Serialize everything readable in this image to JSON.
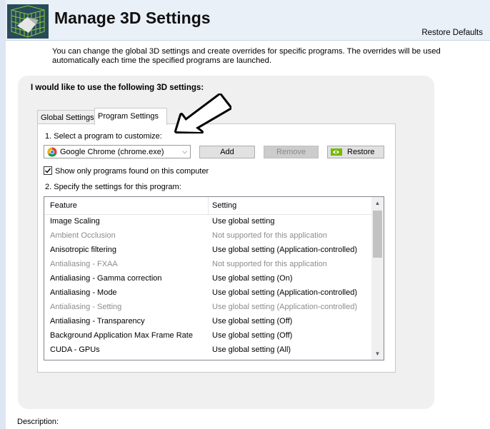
{
  "header": {
    "title": "Manage 3D Settings",
    "restore_defaults": "Restore Defaults",
    "icon": "nvidia-3d-cube-icon"
  },
  "intro": "You can change the global 3D settings and create overrides for specific programs. The overrides will be used automatically each time the specified programs are launched.",
  "panel": {
    "heading": "I would like to use the following 3D settings:",
    "tabs": [
      {
        "label": "Global Settings",
        "active": false
      },
      {
        "label": "Program Settings",
        "active": true
      }
    ]
  },
  "program_settings": {
    "step1_label": "1. Select a program to customize:",
    "selected_program": "Google Chrome (chrome.exe)",
    "add_label": "Add",
    "remove_label": "Remove",
    "restore_label": "Restore",
    "show_only_label": "Show only programs found on this computer",
    "show_only_checked": true,
    "step2_label": "2. Specify the settings for this program:"
  },
  "table": {
    "columns": [
      "Feature",
      "Setting"
    ],
    "rows": [
      {
        "feature": "Image Scaling",
        "setting": "Use global setting",
        "disabled": false
      },
      {
        "feature": "Ambient Occlusion",
        "setting": "Not supported for this application",
        "disabled": true
      },
      {
        "feature": "Anisotropic filtering",
        "setting": "Use global setting (Application-controlled)",
        "disabled": false
      },
      {
        "feature": "Antialiasing - FXAA",
        "setting": "Not supported for this application",
        "disabled": true
      },
      {
        "feature": "Antialiasing - Gamma correction",
        "setting": "Use global setting (On)",
        "disabled": false
      },
      {
        "feature": "Antialiasing - Mode",
        "setting": "Use global setting (Application-controlled)",
        "disabled": false
      },
      {
        "feature": "Antialiasing - Setting",
        "setting": "Use global setting (Application-controlled)",
        "disabled": true
      },
      {
        "feature": "Antialiasing - Transparency",
        "setting": "Use global setting (Off)",
        "disabled": false
      },
      {
        "feature": "Background Application Max Frame Rate",
        "setting": "Use global setting (Off)",
        "disabled": false
      },
      {
        "feature": "CUDA - GPUs",
        "setting": "Use global setting (All)",
        "disabled": false
      }
    ]
  },
  "description_label": "Description:",
  "colors": {
    "header_bg": "#eaf0f8",
    "panel_bg": "#f0f0f0",
    "disabled_text": "#8c8c8c",
    "nvidia_green": "#76b900"
  }
}
